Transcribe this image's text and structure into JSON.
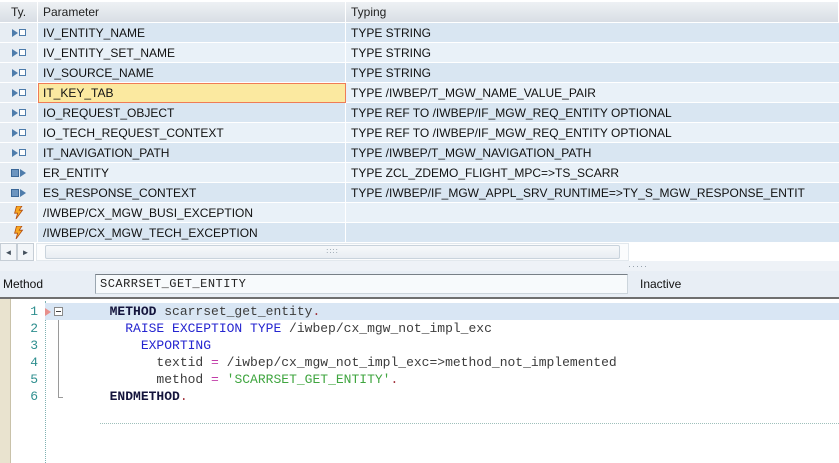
{
  "colors": {
    "selection_yellow": "#fbe9a0",
    "selection_border": "#ef7c56",
    "row_blue_dark": "#d9e6f2",
    "row_blue_light": "#e9f1f8",
    "keyword_blue": "#2525d0",
    "string_green": "#3fa53f",
    "operator_magenta": "#c23ca8",
    "line_number_teal": "#2f8f8f",
    "exception_icon_orange": "#f7a821",
    "param_icon_blue": "#4e7cab"
  },
  "icons": {
    "importing": "importing-parameter-icon",
    "exporting": "exporting-parameter-icon",
    "exception": "exception-icon",
    "scroll_left": "scroll-left-arrow-icon",
    "scroll_right": "scroll-right-arrow-icon",
    "fold_collapse": "fold-collapse-icon",
    "current_line_marker": "current-line-marker-icon"
  },
  "signature_table": {
    "headers": {
      "type": "Ty.",
      "parameter": "Parameter",
      "typing": "Typing"
    },
    "rows": [
      {
        "kind": "importing",
        "parameter": "IV_ENTITY_NAME",
        "typing": "TYPE STRING",
        "selected": false
      },
      {
        "kind": "importing",
        "parameter": "IV_ENTITY_SET_NAME",
        "typing": "TYPE STRING",
        "selected": false
      },
      {
        "kind": "importing",
        "parameter": "IV_SOURCE_NAME",
        "typing": "TYPE STRING",
        "selected": false
      },
      {
        "kind": "importing",
        "parameter": "IT_KEY_TAB",
        "typing": "TYPE /IWBEP/T_MGW_NAME_VALUE_PAIR",
        "selected": true
      },
      {
        "kind": "importing",
        "parameter": "IO_REQUEST_OBJECT",
        "typing": "TYPE REF TO /IWBEP/IF_MGW_REQ_ENTITY OPTIONAL",
        "selected": false
      },
      {
        "kind": "importing",
        "parameter": "IO_TECH_REQUEST_CONTEXT",
        "typing": "TYPE REF TO /IWBEP/IF_MGW_REQ_ENTITY OPTIONAL",
        "selected": false
      },
      {
        "kind": "importing",
        "parameter": "IT_NAVIGATION_PATH",
        "typing": "TYPE /IWBEP/T_MGW_NAVIGATION_PATH",
        "selected": false
      },
      {
        "kind": "exporting",
        "parameter": "ER_ENTITY",
        "typing": "TYPE ZCL_ZDEMO_FLIGHT_MPC=>TS_SCARR",
        "selected": false
      },
      {
        "kind": "exporting",
        "parameter": "ES_RESPONSE_CONTEXT",
        "typing": "TYPE /IWBEP/IF_MGW_APPL_SRV_RUNTIME=>TY_S_MGW_RESPONSE_ENTIT",
        "selected": false
      },
      {
        "kind": "exception",
        "parameter": "/IWBEP/CX_MGW_BUSI_EXCEPTION",
        "typing": "",
        "selected": false
      },
      {
        "kind": "exception",
        "parameter": "/IWBEP/CX_MGW_TECH_EXCEPTION",
        "typing": "",
        "selected": false
      }
    ]
  },
  "scrollbar": {
    "left_arrow": "◄",
    "right_arrow": "►",
    "grip": "∷∷",
    "splitter_grip": "·····"
  },
  "method_bar": {
    "label": "Method",
    "value": "SCARRSET_GET_ENTITY",
    "status": "Inactive"
  },
  "editor": {
    "lines": [
      {
        "n": "1",
        "indent": 2,
        "current": true,
        "fold": "start",
        "segments": [
          {
            "t": "METHOD",
            "c": "kwb"
          },
          {
            "t": " scarrset_get_entity",
            "c": "id"
          },
          {
            "t": ".",
            "c": "dot"
          }
        ]
      },
      {
        "n": "2",
        "indent": 4,
        "current": false,
        "fold": "line",
        "segments": [
          {
            "t": "RAISE EXCEPTION TYPE",
            "c": "kw"
          },
          {
            "t": " /iwbep/cx_mgw_not_impl_exc",
            "c": "id"
          }
        ]
      },
      {
        "n": "3",
        "indent": 6,
        "current": false,
        "fold": "line",
        "segments": [
          {
            "t": "EXPORTING",
            "c": "kw"
          }
        ]
      },
      {
        "n": "4",
        "indent": 8,
        "current": false,
        "fold": "line",
        "segments": [
          {
            "t": "textid ",
            "c": "id"
          },
          {
            "t": "=",
            "c": "op"
          },
          {
            "t": " /iwbep/cx_mgw_not_impl_exc=>method_not_implemented",
            "c": "id"
          }
        ]
      },
      {
        "n": "5",
        "indent": 8,
        "current": false,
        "fold": "line",
        "segments": [
          {
            "t": "method ",
            "c": "id"
          },
          {
            "t": "=",
            "c": "op"
          },
          {
            "t": " ",
            "c": "id"
          },
          {
            "t": "'SCARRSET_GET_ENTITY'",
            "c": "str"
          },
          {
            "t": ".",
            "c": "dot"
          }
        ]
      },
      {
        "n": "6",
        "indent": 2,
        "current": false,
        "fold": "end",
        "segments": [
          {
            "t": "ENDMETHOD",
            "c": "kwb"
          },
          {
            "t": ".",
            "c": "dot"
          }
        ]
      }
    ]
  }
}
